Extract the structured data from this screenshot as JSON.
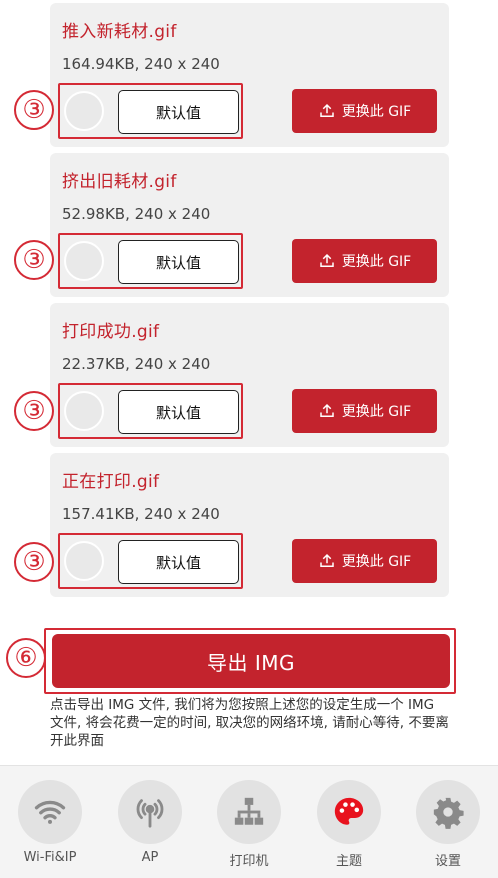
{
  "cards": [
    {
      "title": "推入新耗材.gif",
      "meta": "164.94KB, 240 x 240",
      "default_label": "默认值",
      "swap_label": "更换此 GIF"
    },
    {
      "title": "挤出旧耗材.gif",
      "meta": "52.98KB, 240 x 240",
      "default_label": "默认值",
      "swap_label": "更换此 GIF"
    },
    {
      "title": "打印成功.gif",
      "meta": "22.37KB, 240 x 240",
      "default_label": "默认值",
      "swap_label": "更换此 GIF"
    },
    {
      "title": "正在打印.gif",
      "meta": "157.41KB, 240 x 240",
      "default_label": "默认值",
      "swap_label": "更换此 GIF"
    }
  ],
  "annotations": {
    "step_a": "③",
    "step_b": "⑥"
  },
  "export": {
    "label": "导出 IMG",
    "note": "点击导出 IMG 文件, 我们将为您按照上述您的设定生成一个 IMG 文件, 将会花费一定的时间, 取决您的网络环境, 请耐心等待, 不要离开此界面"
  },
  "tabs": [
    {
      "label": "Wi-Fi&IP",
      "icon": "wifi-icon"
    },
    {
      "label": "AP",
      "icon": "broadcast-icon"
    },
    {
      "label": "打印机",
      "icon": "network-tree-icon"
    },
    {
      "label": "主题",
      "icon": "palette-icon"
    },
    {
      "label": "设置",
      "icon": "gear-icon"
    }
  ],
  "colors": {
    "accent": "#c3232d",
    "annotation": "#d42a35",
    "card_bg": "#f0f0f0",
    "tab_icon_inactive": "#8a8a8a"
  }
}
